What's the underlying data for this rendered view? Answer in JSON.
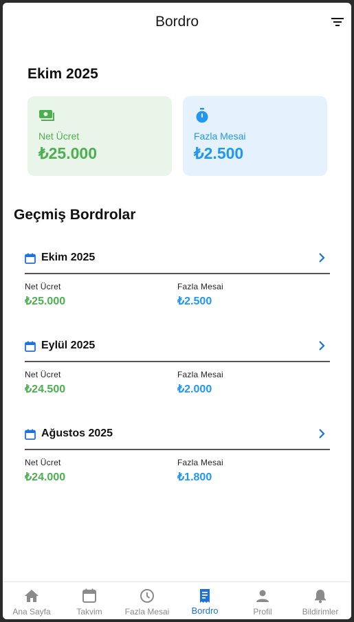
{
  "appbar": {
    "title": "Bordro"
  },
  "summary": {
    "month": "Ekim 2025",
    "net": {
      "label": "Net Ücret",
      "value": "₺25.000"
    },
    "overtime": {
      "label": "Fazla Mesai",
      "value": "₺2.500"
    }
  },
  "history": {
    "title": "Geçmiş Bordrolar",
    "entries": [
      {
        "month": "Ekim 2025",
        "net_label": "Net Ücret",
        "net": "₺25.000",
        "ot_label": "Fazla Mesai",
        "ot": "₺2.500"
      },
      {
        "month": "Eylül 2025",
        "net_label": "Net Ücret",
        "net": "₺24.500",
        "ot_label": "Fazla Mesai",
        "ot": "₺2.000"
      },
      {
        "month": "Ağustos 2025",
        "net_label": "Net Ücret",
        "net": "₺24.000",
        "ot_label": "Fazla Mesai",
        "ot": "₺1.800"
      }
    ]
  },
  "nav": {
    "items": [
      {
        "label": "Ana Sayfa",
        "icon": "home-icon"
      },
      {
        "label": "Takvim",
        "icon": "calendar-icon"
      },
      {
        "label": "Fazla Mesai",
        "icon": "clock-icon"
      },
      {
        "label": "Bordro",
        "icon": "receipt-icon",
        "active": true
      },
      {
        "label": "Profil",
        "icon": "person-icon"
      },
      {
        "label": "Bildirimler",
        "icon": "bell-icon"
      }
    ]
  },
  "colors": {
    "green": "#4caf50",
    "blue": "#2196f3",
    "active": "#1e6fe0",
    "inactive": "#8a8a8a"
  }
}
